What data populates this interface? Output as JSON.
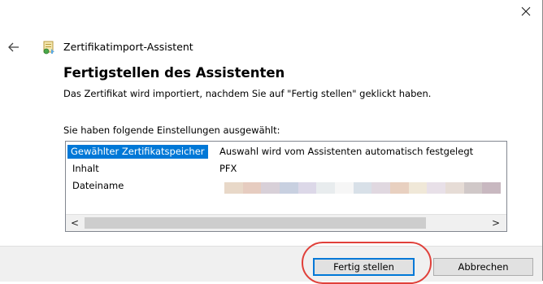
{
  "window": {
    "close_glyph": "✕"
  },
  "nav": {
    "back_glyph": "←"
  },
  "wizard": {
    "title": "Zertifikatimport-Assistent",
    "heading": "Fertigstellen des Assistenten",
    "description": "Das Zertifikat wird importiert, nachdem Sie auf \"Fertig stellen\" geklickt haben.",
    "settings_label": "Sie haben folgende Einstellungen ausgewählt:"
  },
  "settings": {
    "rows": [
      {
        "key": "Gewählter Zertifikatspeicher",
        "value": "Auswahl wird vom Assistenten automatisch festgelegt",
        "selected": true
      },
      {
        "key": "Inhalt",
        "value": "PFX",
        "selected": false
      },
      {
        "key": "Dateiname",
        "value": "",
        "selected": false,
        "redacted": true
      }
    ],
    "redaction_colors": [
      "#e8d8c8",
      "#e6ccc0",
      "#d8d0d8",
      "#c8d0e0",
      "#dcd8e8",
      "#e8ecee",
      "#f6f6f6",
      "#d8e0e8",
      "#e0d8e0",
      "#e8d0c0",
      "#f0e8d8",
      "#e8e0e8",
      "#e6dcd6",
      "#d0c8c8",
      "#c8b8c0"
    ]
  },
  "scrollbar": {
    "left_glyph": "<",
    "right_glyph": ">"
  },
  "buttons": {
    "finish": "Fertig stellen",
    "cancel": "Abbrechen"
  },
  "colors": {
    "selection": "#0078d7",
    "highlight_ring": "#e0403a",
    "footer": "#f0f0f0"
  }
}
